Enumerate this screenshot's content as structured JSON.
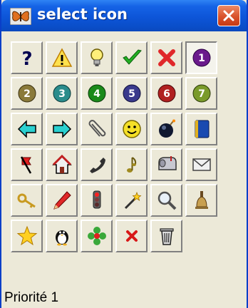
{
  "window": {
    "title": "select icon"
  },
  "colors": {
    "titlebar": "#0d55d8",
    "close_button": "#d9522b",
    "face": "#ece9d8"
  },
  "icons": [
    "question-icon",
    "warning-icon",
    "lightbulb-icon",
    "checkmark-icon",
    "red-x-icon",
    "number-1-icon",
    "number-2-icon",
    "number-3-icon",
    "number-4-icon",
    "number-5-icon",
    "number-6-icon",
    "number-7-icon",
    "arrow-left-icon",
    "arrow-right-icon",
    "paperclip-icon",
    "smiley-icon",
    "bomb-icon",
    "blue-book-icon",
    "flag-icon",
    "house-icon",
    "telephone-icon",
    "music-note-icon",
    "mailbox-icon",
    "envelope-icon",
    "key-icon",
    "pencil-icon",
    "traffic-light-icon",
    "magic-wand-icon",
    "magnifier-icon",
    "bell-icon",
    "star-icon",
    "penguin-icon",
    "flower-icon",
    "small-red-x-icon",
    "trash-can-icon"
  ],
  "number_badges": [
    "1",
    "2",
    "3",
    "4",
    "5",
    "6",
    "7"
  ],
  "status": {
    "text": "Priorité 1"
  }
}
